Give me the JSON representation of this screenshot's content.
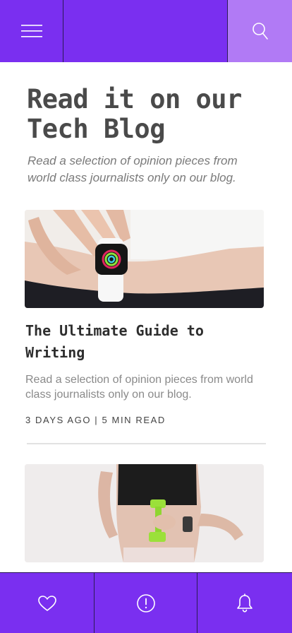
{
  "header": {
    "menu_icon": "hamburger-menu-icon",
    "search_icon": "search-icon"
  },
  "hero": {
    "title": "Read it on our Tech Blog",
    "subtitle": "Read a selection of opinion pieces from world class journalists only on our blog."
  },
  "posts": [
    {
      "image": "smartwatch-on-wrist-photo",
      "title": "The Ultimate Guide to Writing",
      "excerpt": "Read a selection of opinion pieces from world class journalists only on our blog.",
      "meta": "3 DAYS AGO | 5 MIN READ"
    },
    {
      "image": "woman-with-dumbbell-photo"
    }
  ],
  "bottom_nav": {
    "items": [
      "heart-icon",
      "alert-circle-icon",
      "bell-icon"
    ]
  },
  "colors": {
    "accent": "#7a2ff0",
    "accent_light": "#b17af5"
  }
}
